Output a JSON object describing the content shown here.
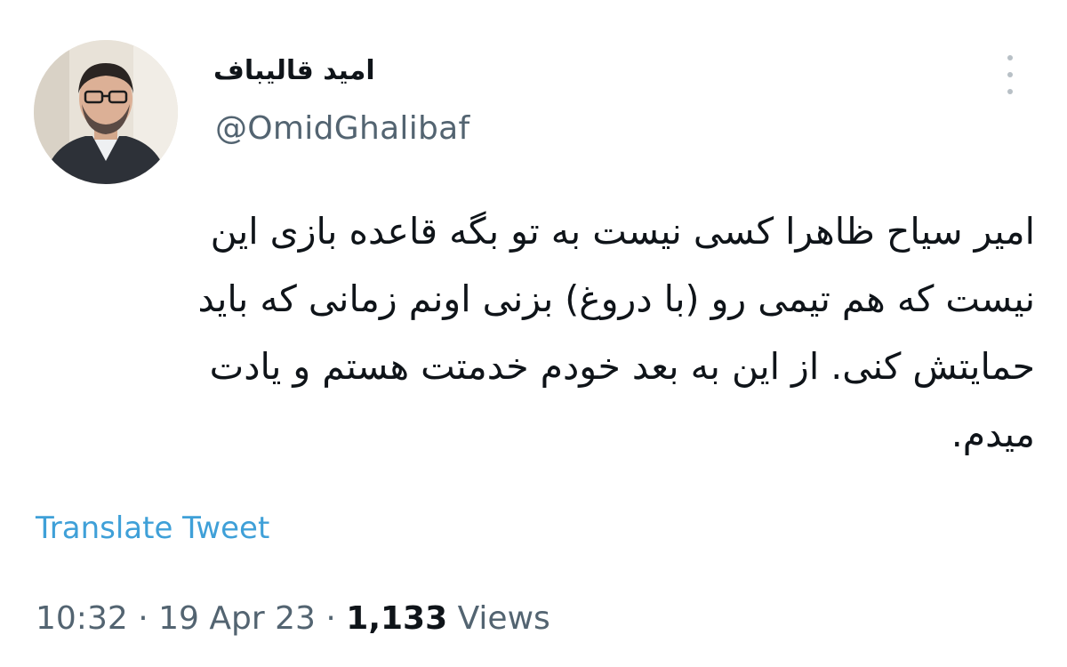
{
  "author": {
    "display_name": "امید قالیباف",
    "handle": "@OmidGhalibaf",
    "avatar_icon": "profile-photo"
  },
  "tweet": {
    "lines": [
      "امیر سیاح ظاهرا کسی نیست به تو بگه قاعده بازی این",
      "نیست که هم تیمی رو (با دروغ) بزنی اونم زمانی که باید",
      "حمایتش کنی. از این به بعد خودم خدمتت هستم و یادت",
      "میدم."
    ],
    "translate_label": "Translate Tweet"
  },
  "meta": {
    "time": "10:32",
    "separator": "·",
    "date": "19 Apr 23",
    "views_count": "1,133",
    "views_label": "Views"
  },
  "colors": {
    "link": "#3fa0d8",
    "secondary_text": "#536471",
    "primary_text": "#0f1419"
  },
  "icons": {
    "more": "more-vertical-icon"
  }
}
